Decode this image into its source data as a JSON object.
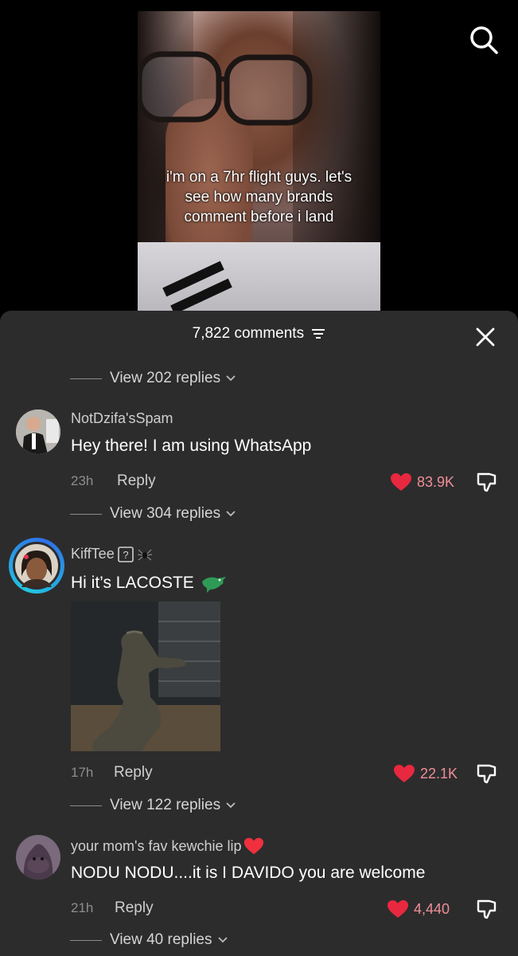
{
  "video": {
    "caption_lines": [
      "i'm on a 7hr flight guys. let's",
      "see how many brands",
      "comment before i land"
    ]
  },
  "search_icon": "search-icon",
  "sheet": {
    "comments_count": "7,822 comments",
    "top_view_replies": "View 202 replies"
  },
  "comments": [
    {
      "username": "NotDzifa'sSpam",
      "text": "Hey there! I am using WhatsApp",
      "time": "23h",
      "reply": "Reply",
      "likes": "83.9K",
      "view_replies": "View 304 replies"
    },
    {
      "username": "KiffTee",
      "username_emojis": "❓🕷",
      "text": "Hi it’s LACOSTE",
      "text_emoji": "🐊",
      "time": "17h",
      "reply": "Reply",
      "likes": "22.1K",
      "view_replies": "View 122 replies",
      "has_image": true
    },
    {
      "username": "your mom's fav kewchie lip",
      "username_emoji": "❤️",
      "text": "NODU NODU....it is I DAVIDO you are welcome",
      "time": "21h",
      "reply": "Reply",
      "likes": "4,440",
      "view_replies": "View 40 replies"
    }
  ],
  "colors": {
    "sheet_bg": "#2c2c2d",
    "heart": "#e8283f",
    "likes_text": "#ee8f96"
  }
}
